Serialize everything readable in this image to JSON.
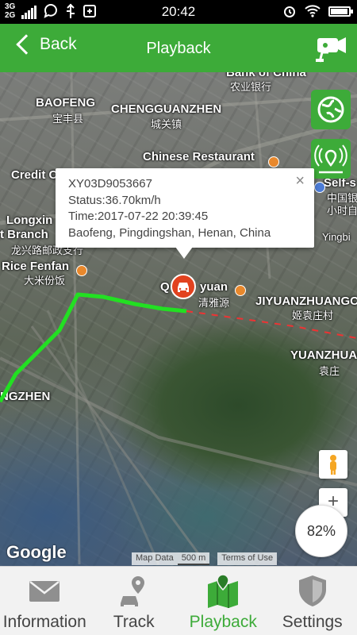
{
  "status_bar": {
    "network_top": "3G",
    "network_bottom": "2G",
    "time": "20:42",
    "battery_level": 0.95
  },
  "header": {
    "back_label": "Back",
    "title": "Playback"
  },
  "map": {
    "labels": [
      {
        "text": "Bank of China"
      },
      {
        "text": "农业银行"
      },
      {
        "text": "BAOFENG"
      },
      {
        "text": "宝丰县"
      },
      {
        "text": "CHENGGUANZHEN"
      },
      {
        "text": "城关镇"
      },
      {
        "text": "Chinese Restaurant"
      },
      {
        "text": "Credit C"
      },
      {
        "text": "Self-s"
      },
      {
        "text": "中国银"
      },
      {
        "text": "小时自"
      },
      {
        "text": "Longxin"
      },
      {
        "text": "t Branch"
      },
      {
        "text": "龙兴路邮政支行"
      },
      {
        "text": "Yingbi"
      },
      {
        "text": "Rice Fenfan"
      },
      {
        "text": "大米份饭"
      },
      {
        "text": "Q"
      },
      {
        "text": "yuan"
      },
      {
        "text": "清雅源"
      },
      {
        "text": "JIYUANZHUANGC"
      },
      {
        "text": "姬袁庄村"
      },
      {
        "text": "YUANZHUAN"
      },
      {
        "text": "袁庄"
      },
      {
        "text": "NGZHEN"
      }
    ],
    "google_logo": "Google",
    "attribution": {
      "map_data": "Map Data",
      "scale": "500 m",
      "terms": "Terms of Use"
    },
    "zoom_in": "+",
    "speed_percent": "82%"
  },
  "info_window": {
    "device_id": "XY03D9053667",
    "status": "Status:36.70km/h",
    "time": "Time:2017-07-22 20:39:45",
    "address": "Baofeng, Pingdingshan, Henan, China",
    "close": "×"
  },
  "bottom_nav": {
    "items": [
      {
        "label": "Information",
        "icon": "envelope-icon",
        "active": false
      },
      {
        "label": "Track",
        "icon": "car-pin-icon",
        "active": false
      },
      {
        "label": "Playback",
        "icon": "map-pin-icon",
        "active": true
      },
      {
        "label": "Settings",
        "icon": "shield-icon",
        "active": false
      }
    ]
  },
  "colors": {
    "brand_green": "#3dab39",
    "track_green": "#22e022",
    "marker_red": "#e2421f"
  }
}
